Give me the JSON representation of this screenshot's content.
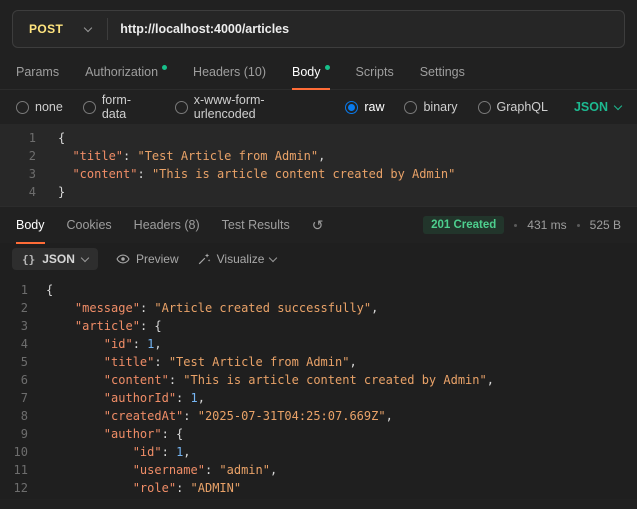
{
  "request": {
    "method": "POST",
    "url": "http://localhost:4000/articles",
    "tabs": [
      {
        "label": "Params"
      },
      {
        "label": "Authorization"
      },
      {
        "label": "Headers (10)"
      },
      {
        "label": "Body"
      },
      {
        "label": "Scripts"
      },
      {
        "label": "Settings"
      }
    ],
    "body_types": [
      {
        "label": "none"
      },
      {
        "label": "form-data"
      },
      {
        "label": "x-www-form-urlencoded"
      },
      {
        "label": "raw"
      },
      {
        "label": "binary"
      },
      {
        "label": "GraphQL"
      }
    ],
    "language": "JSON",
    "editor": {
      "lines": [
        {
          "n": "1",
          "t": [
            {
              "c": "p",
              "s": "{"
            }
          ]
        },
        {
          "n": "2",
          "t": [
            {
              "c": "p",
              "s": "  "
            },
            {
              "c": "k",
              "s": "\"title\""
            },
            {
              "c": "p",
              "s": ": "
            },
            {
              "c": "s",
              "s": "\"Test Article from Admin\""
            },
            {
              "c": "p",
              "s": ","
            }
          ]
        },
        {
          "n": "3",
          "t": [
            {
              "c": "p",
              "s": "  "
            },
            {
              "c": "k",
              "s": "\"content\""
            },
            {
              "c": "p",
              "s": ": "
            },
            {
              "c": "s",
              "s": "\"This is article content created by Admin\""
            }
          ]
        },
        {
          "n": "4",
          "t": [
            {
              "c": "p",
              "s": "}"
            }
          ]
        }
      ]
    }
  },
  "response": {
    "tabs": [
      {
        "label": "Body"
      },
      {
        "label": "Cookies"
      },
      {
        "label": "Headers (8)"
      },
      {
        "label": "Test Results"
      }
    ],
    "status": "201 Created",
    "time": "431 ms",
    "size": "525 B",
    "viewer": {
      "format": "JSON",
      "braces_icon": "{}",
      "preview_label": "Preview",
      "visualize_label": "Visualize"
    },
    "body": {
      "lines": [
        {
          "n": "1",
          "t": [
            {
              "c": "p",
              "s": "{"
            }
          ]
        },
        {
          "n": "2",
          "t": [
            {
              "c": "p",
              "s": "    "
            },
            {
              "c": "k",
              "s": "\"message\""
            },
            {
              "c": "p",
              "s": ": "
            },
            {
              "c": "s",
              "s": "\"Article created successfully\""
            },
            {
              "c": "p",
              "s": ","
            }
          ]
        },
        {
          "n": "3",
          "t": [
            {
              "c": "p",
              "s": "    "
            },
            {
              "c": "k",
              "s": "\"article\""
            },
            {
              "c": "p",
              "s": ": "
            },
            {
              "c": "p",
              "s": "{"
            }
          ]
        },
        {
          "n": "4",
          "t": [
            {
              "c": "p",
              "s": "        "
            },
            {
              "c": "k",
              "s": "\"id\""
            },
            {
              "c": "p",
              "s": ": "
            },
            {
              "c": "n",
              "s": "1"
            },
            {
              "c": "p",
              "s": ","
            }
          ]
        },
        {
          "n": "5",
          "t": [
            {
              "c": "p",
              "s": "        "
            },
            {
              "c": "k",
              "s": "\"title\""
            },
            {
              "c": "p",
              "s": ": "
            },
            {
              "c": "s",
              "s": "\"Test Article from Admin\""
            },
            {
              "c": "p",
              "s": ","
            }
          ]
        },
        {
          "n": "6",
          "t": [
            {
              "c": "p",
              "s": "        "
            },
            {
              "c": "k",
              "s": "\"content\""
            },
            {
              "c": "p",
              "s": ": "
            },
            {
              "c": "s",
              "s": "\"This is article content created by Admin\""
            },
            {
              "c": "p",
              "s": ","
            }
          ]
        },
        {
          "n": "7",
          "t": [
            {
              "c": "p",
              "s": "        "
            },
            {
              "c": "k",
              "s": "\"authorId\""
            },
            {
              "c": "p",
              "s": ": "
            },
            {
              "c": "n",
              "s": "1"
            },
            {
              "c": "p",
              "s": ","
            }
          ]
        },
        {
          "n": "8",
          "t": [
            {
              "c": "p",
              "s": "        "
            },
            {
              "c": "k",
              "s": "\"createdAt\""
            },
            {
              "c": "p",
              "s": ": "
            },
            {
              "c": "s",
              "s": "\"2025-07-31T04:25:07.669Z\""
            },
            {
              "c": "p",
              "s": ","
            }
          ]
        },
        {
          "n": "9",
          "t": [
            {
              "c": "p",
              "s": "        "
            },
            {
              "c": "k",
              "s": "\"author\""
            },
            {
              "c": "p",
              "s": ": "
            },
            {
              "c": "p",
              "s": "{"
            }
          ]
        },
        {
          "n": "10",
          "t": [
            {
              "c": "p",
              "s": "            "
            },
            {
              "c": "k",
              "s": "\"id\""
            },
            {
              "c": "p",
              "s": ": "
            },
            {
              "c": "n",
              "s": "1"
            },
            {
              "c": "p",
              "s": ","
            }
          ]
        },
        {
          "n": "11",
          "t": [
            {
              "c": "p",
              "s": "            "
            },
            {
              "c": "k",
              "s": "\"username\""
            },
            {
              "c": "p",
              "s": ": "
            },
            {
              "c": "s",
              "s": "\"admin\""
            },
            {
              "c": "p",
              "s": ","
            }
          ]
        },
        {
          "n": "12",
          "t": [
            {
              "c": "p",
              "s": "            "
            },
            {
              "c": "k",
              "s": "\"role\""
            },
            {
              "c": "p",
              "s": ": "
            },
            {
              "c": "s",
              "s": "\"ADMIN\""
            }
          ]
        }
      ]
    }
  },
  "colors": {
    "accent_orange": "#ff6c37",
    "method_post": "#ffe47e",
    "tab_dot_green": "#17c08a",
    "status_green": "#4dcf8e",
    "radio_selected_blue": "#097bed",
    "language_teal": "#1db990",
    "json_key": "#f08d67",
    "json_string": "#e9a268",
    "json_number": "#76b6f4"
  }
}
